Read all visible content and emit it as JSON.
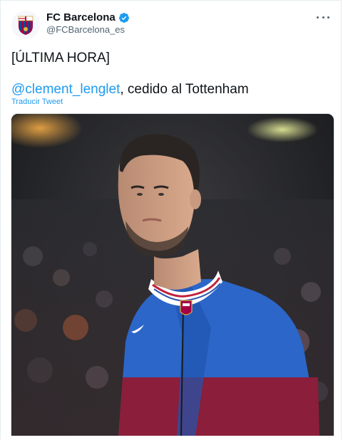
{
  "account": {
    "name": "FC Barcelona",
    "handle": "@FCBarcelona_es"
  },
  "tweet": {
    "line1": "[ÚLTIMA HORA]",
    "mention": "@clement_lenglet",
    "rest": ", cedido al Tottenham",
    "translate": "Traducir Tweet"
  },
  "icons": {
    "verified": "verified-badge-icon",
    "more": "more-options-icon"
  },
  "colors": {
    "link": "#1d9bf0",
    "text": "#0f1419",
    "muted": "#536471",
    "barca_blue": "#1f5fbf",
    "barca_red": "#8e1f3a"
  }
}
